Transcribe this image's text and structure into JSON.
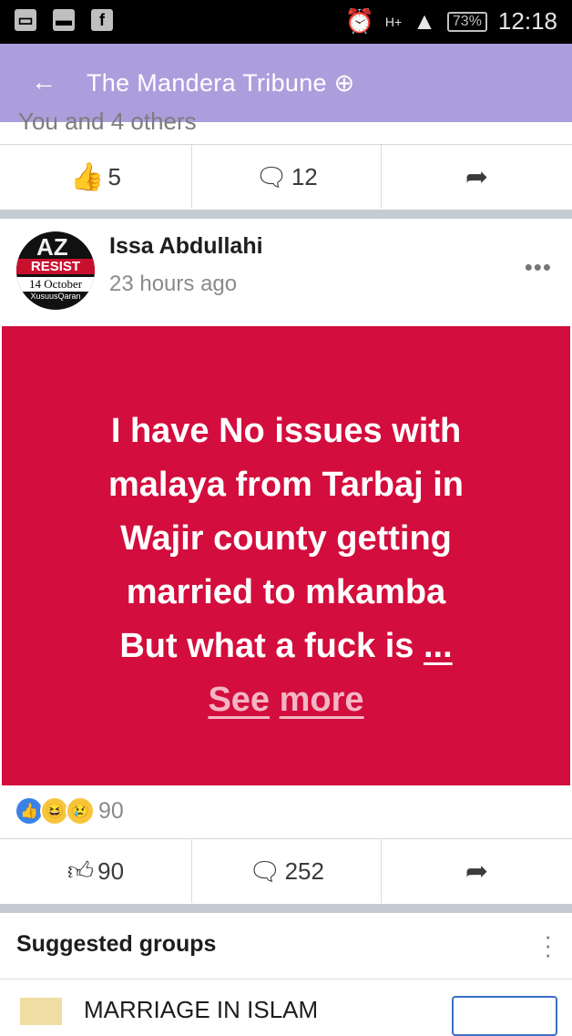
{
  "status_bar": {
    "network": "H+",
    "battery": "73%",
    "time": "12:18"
  },
  "header": {
    "back_arrow": "←",
    "title": "The Mandera Tribune"
  },
  "prev_post": {
    "cut_text": "You and 4 others",
    "likes": "5",
    "comments": "12"
  },
  "post": {
    "author": "Issa Abdullahi",
    "time": "23 hours ago",
    "avatar": {
      "line1": "AZ",
      "line2": "RESIST",
      "line3": "14 October",
      "line4": "XusuusQaran"
    },
    "text_lines": [
      "I have No issues with",
      "malaya from Tarbaj in",
      "Wajir county getting",
      "married to mkamba",
      "But what a fuck is"
    ],
    "ellipsis": "...",
    "see_more_1": "See",
    "see_more_2": "more",
    "reaction_count": "90",
    "likes": "90",
    "comments": "252"
  },
  "suggested": {
    "title": "Suggested groups",
    "first_group": "MARRIAGE IN ISLAM"
  },
  "colors": {
    "header_bg": "#ac9edc",
    "post_bg": "#d30d3d",
    "like_blue": "#3b82e6"
  }
}
